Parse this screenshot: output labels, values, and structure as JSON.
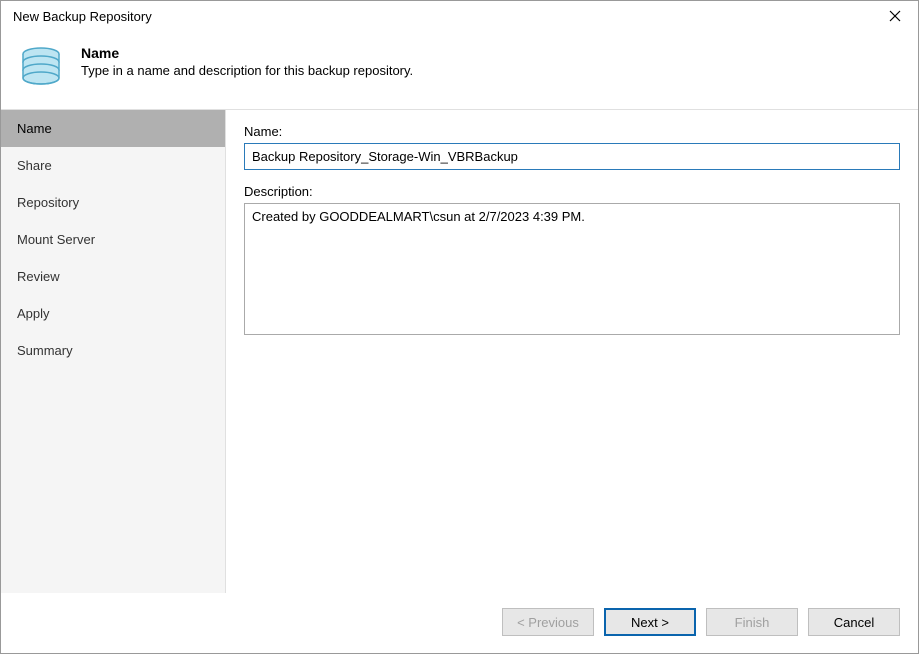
{
  "window": {
    "title": "New Backup Repository"
  },
  "header": {
    "title": "Name",
    "subtitle": "Type in a name and description for this backup repository."
  },
  "sidebar": {
    "items": [
      {
        "label": "Name",
        "active": true
      },
      {
        "label": "Share",
        "active": false
      },
      {
        "label": "Repository",
        "active": false
      },
      {
        "label": "Mount Server",
        "active": false
      },
      {
        "label": "Review",
        "active": false
      },
      {
        "label": "Apply",
        "active": false
      },
      {
        "label": "Summary",
        "active": false
      }
    ]
  },
  "form": {
    "name_label": "Name:",
    "name_value": "Backup Repository_Storage-Win_VBRBackup",
    "description_label": "Description:",
    "description_value": "Created by GOODDEALMART\\csun at 2/7/2023 4:39 PM."
  },
  "footer": {
    "previous": "< Previous",
    "next": "Next >",
    "finish": "Finish",
    "cancel": "Cancel"
  }
}
